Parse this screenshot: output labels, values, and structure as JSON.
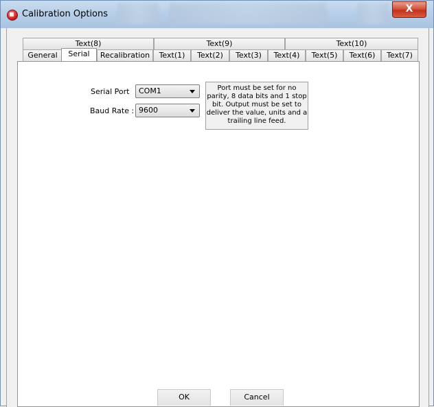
{
  "window": {
    "title": "Calibration Options",
    "close_label": "X"
  },
  "tabs": {
    "row_top": [
      "Text(8)",
      "Text(9)",
      "Text(10)"
    ],
    "row_bottom": [
      "General",
      "Serial",
      "Recalibration",
      "Text(1)",
      "Text(2)",
      "Text(3)",
      "Text(4)",
      "Text(5)",
      "Text(6)",
      "Text(7)"
    ],
    "selected": "Serial"
  },
  "serial": {
    "port_label": "Serial Port",
    "port_value": "COM1",
    "baud_label": "Baud Rate :",
    "baud_value": "9600",
    "note": "Port must be set for no parity, 8 data bits and 1 stop bit. Output must be set to deliver the value, units and a trailing line feed."
  },
  "buttons": {
    "ok": "OK",
    "cancel": "Cancel"
  },
  "colors": {
    "titlebar": "#b8cfe8",
    "close": "#c3321c",
    "background": "#f0f0f0"
  }
}
